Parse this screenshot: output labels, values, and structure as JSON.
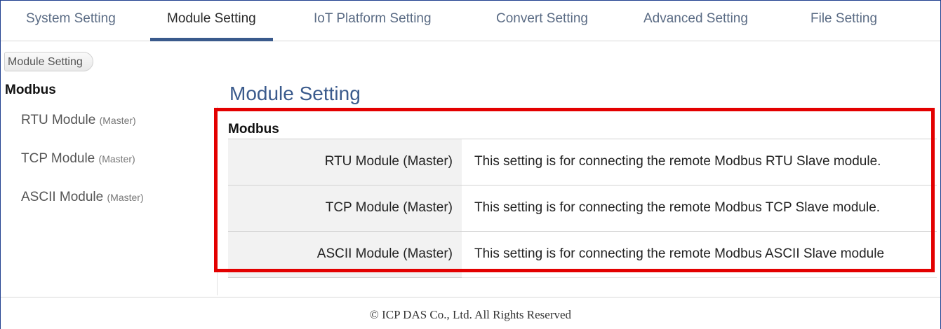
{
  "tabs": [
    {
      "label": "System Setting",
      "active": false
    },
    {
      "label": "Module Setting",
      "active": true
    },
    {
      "label": "IoT Platform Setting",
      "active": false
    },
    {
      "label": "Convert Setting",
      "active": false
    },
    {
      "label": "Advanced Setting",
      "active": false
    },
    {
      "label": "File Setting",
      "active": false
    }
  ],
  "breadcrumb": "Module Setting",
  "sidebar": {
    "heading": "Modbus",
    "items": [
      {
        "label": "RTU Module",
        "note": "(Master)"
      },
      {
        "label": "TCP Module",
        "note": "(Master)"
      },
      {
        "label": "ASCII Module",
        "note": "(Master)"
      }
    ]
  },
  "main": {
    "title": "Module Setting",
    "section": "Modbus",
    "rows": [
      {
        "label": "RTU Module (Master)",
        "description": "This setting is for connecting the remote Modbus RTU Slave module."
      },
      {
        "label": "TCP Module (Master)",
        "description": "This setting is for connecting the remote Modbus TCP Slave module."
      },
      {
        "label": "ASCII Module (Master)",
        "description": "This setting is for connecting the remote Modbus ASCII Slave module"
      }
    ]
  },
  "footer": "© ICP DAS Co., Ltd. All Rights Reserved",
  "colors": {
    "accent": "#3a5a8c",
    "highlight": "#e30000",
    "frame": "#1f3f8f"
  }
}
